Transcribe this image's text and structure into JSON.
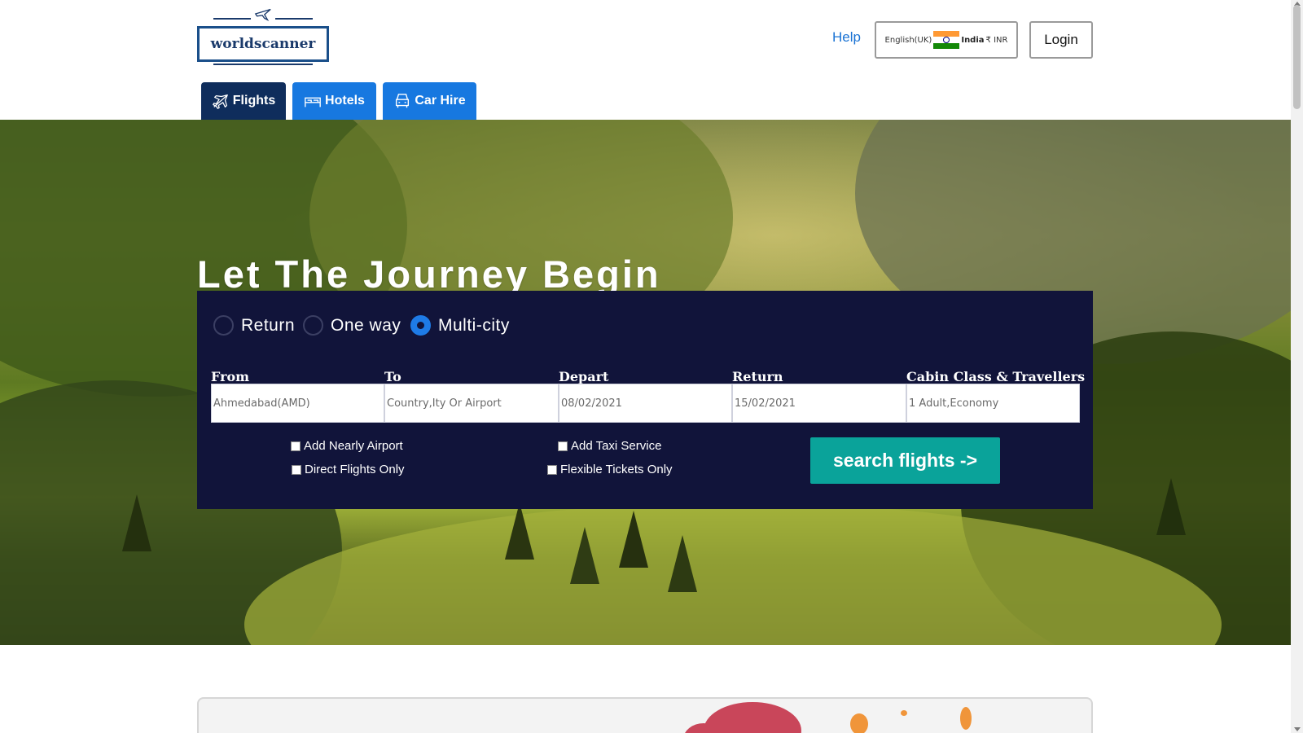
{
  "brand": {
    "name": "worldscanner"
  },
  "header": {
    "help_label": "Help",
    "locale": {
      "language": "English(UK)",
      "country": "India",
      "currency": "₹ INR"
    },
    "login_label": "Login"
  },
  "nav": {
    "tabs": [
      {
        "label": "Flights",
        "icon": "plane-icon",
        "active": true
      },
      {
        "label": "Hotels",
        "icon": "bed-icon",
        "active": false
      },
      {
        "label": "Car Hire",
        "icon": "car-icon",
        "active": false
      }
    ]
  },
  "hero": {
    "title": "Let The Journey Begin"
  },
  "search": {
    "trip_types": [
      {
        "label": "Return",
        "selected": false
      },
      {
        "label": "One way",
        "selected": false
      },
      {
        "label": "Multi-city",
        "selected": true
      }
    ],
    "fields": [
      {
        "label": "From",
        "value": "Ahmedabad(AMD)",
        "placeholder": ""
      },
      {
        "label": "To",
        "value": "",
        "placeholder": "Country,Ity Or Airport"
      },
      {
        "label": "Depart",
        "value": "08/02/2021",
        "placeholder": ""
      },
      {
        "label": "Return",
        "value": "15/02/2021",
        "placeholder": ""
      },
      {
        "label": "Cabin Class & Travellers",
        "value": "1 Adult,Economy",
        "placeholder": ""
      }
    ],
    "options": [
      {
        "label": "Add Nearly Airport",
        "checked": false
      },
      {
        "label": "Direct Flights Only",
        "checked": false
      },
      {
        "label": "Add Taxi Service",
        "checked": false
      },
      {
        "label": "Flexible Tickets Only",
        "checked": false
      }
    ],
    "submit_label": "search flights ->"
  },
  "colors": {
    "nav_active": "#0f2d5c",
    "nav_inactive": "#1778e0",
    "panel_bg": "#11143a",
    "search_button": "#0aa39a",
    "link": "#1a73d4"
  }
}
